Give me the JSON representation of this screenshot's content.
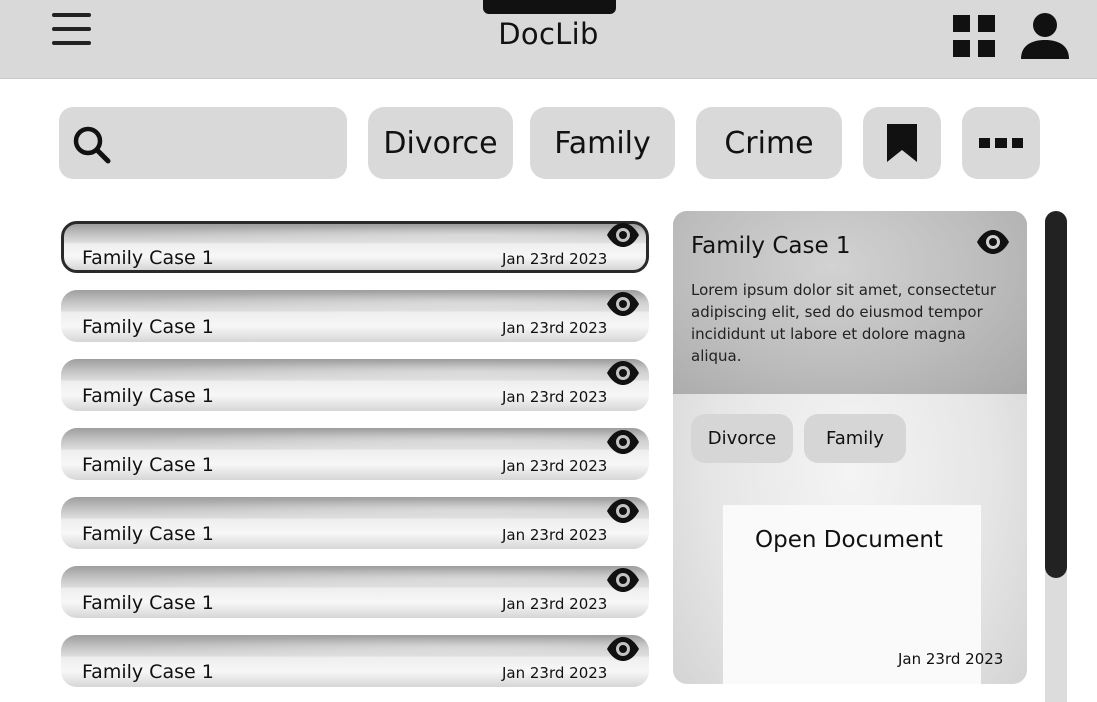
{
  "header": {
    "title": "DocLib",
    "menu_icon": "hamburger-menu-icon",
    "grid_icon": "grid-view-icon",
    "user_icon": "user-icon"
  },
  "filters": {
    "search_placeholder": "",
    "search_icon": "search-icon",
    "chips": [
      "Divorce",
      "Family",
      "Crime"
    ],
    "bookmark_icon": "bookmark-icon",
    "more_icon": "more-icon"
  },
  "documents": [
    {
      "title": "Family Case 1",
      "date": "Jan 23rd 2023",
      "selected": true
    },
    {
      "title": "Family Case 1",
      "date": "Jan 23rd 2023"
    },
    {
      "title": "Family Case 1",
      "date": "Jan 23rd 2023"
    },
    {
      "title": "Family Case 1",
      "date": "Jan 23rd 2023"
    },
    {
      "title": "Family Case 1",
      "date": "Jan 23rd 2023"
    },
    {
      "title": "Family Case 1",
      "date": "Jan 23rd 2023"
    },
    {
      "title": "Family Case 1",
      "date": "Jan 23rd 2023"
    }
  ],
  "detail": {
    "title": "Family Case 1",
    "description": "Lorem ipsum dolor sit amet, consectetur adipiscing elit, sed do eiusmod tempor incididunt ut labore et dolore magna aliqua.",
    "tags": [
      "Divorce",
      "Family"
    ],
    "open_label": "Open Document",
    "date": "Jan 23rd 2023"
  },
  "colors": {
    "header_bg": "#d9d9d9",
    "chip_bg": "#d9d9d9",
    "text": "#111111",
    "scroll_thumb": "#222222"
  }
}
